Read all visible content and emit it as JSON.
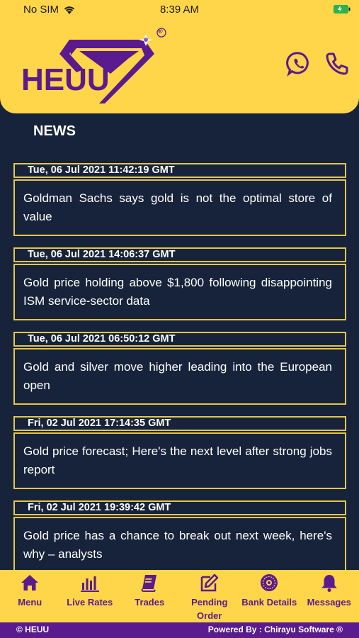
{
  "status_bar": {
    "carrier": "No SIM",
    "time": "8:39 AM"
  },
  "header": {
    "brand_text": "HEUU",
    "registered_mark": "®",
    "whatsapp_icon": "whatsapp-icon",
    "phone_icon": "phone-icon"
  },
  "page": {
    "title": "NEWS"
  },
  "news": [
    {
      "date": "Tue, 06 Jul 2021 11:42:19 GMT",
      "headline": "Goldman Sachs says gold is not the optimal store of value"
    },
    {
      "date": "Tue, 06 Jul 2021 14:06:37 GMT",
      "headline": "Gold price holding above $1,800 following disappointing ISM service-sector data"
    },
    {
      "date": "Tue, 06 Jul 2021 06:50:12 GMT",
      "headline": "Gold and silver move higher leading into the European open"
    },
    {
      "date": "Fri, 02 Jul 2021 17:14:35 GMT",
      "headline": "Gold price forecast; Here's the next level after strong jobs report"
    },
    {
      "date": "Fri, 02 Jul 2021 19:39:42 GMT",
      "headline": "Gold price has a chance to break out next week, here's why – analysts"
    }
  ],
  "tabs": [
    {
      "label": "Menu",
      "icon": "home-icon"
    },
    {
      "label": "Live Rates",
      "icon": "bar-chart-icon"
    },
    {
      "label": "Trades",
      "icon": "book-icon"
    },
    {
      "label": "Pending Order",
      "icon": "edit-icon"
    },
    {
      "label": "Bank Details",
      "icon": "bank-seal-icon"
    },
    {
      "label": "Messages",
      "icon": "bell-icon"
    }
  ],
  "footer": {
    "copyright": "© HEUU",
    "powered_by": "Powered By : Chirayu Software ®"
  },
  "colors": {
    "accent_yellow": "#ffd54a",
    "brand_purple": "#5a1b8e",
    "background": "#17233a",
    "card_border": "#e3c74a"
  }
}
